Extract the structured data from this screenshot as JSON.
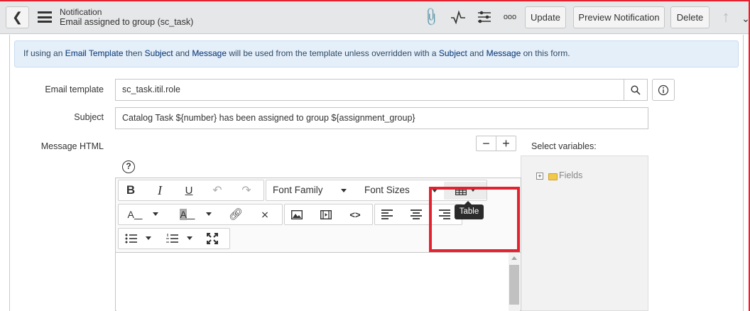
{
  "header": {
    "title": "Notification",
    "subtitle": "Email assigned to group (sc_task)",
    "buttons": {
      "update": "Update",
      "preview": "Preview Notification",
      "delete": "Delete"
    }
  },
  "banner": {
    "p1": "If using an ",
    "b1": "Email Template",
    "p2": " then ",
    "b2": "Subject",
    "p3": " and ",
    "b3": "Message",
    "p4": " will be used from the template unless overridden with a ",
    "b4": "Subject",
    "p5": " and ",
    "b5": "Message",
    "p6": " on this form."
  },
  "form": {
    "email_template_label": "Email template",
    "email_template_value": "sc_task.itil.role",
    "subject_label": "Subject",
    "subject_value": "Catalog Task ${number} has been assigned to group ${assignment_group}",
    "message_label": "Message HTML",
    "select_variables_label": "Select variables:",
    "fields_node": "Fields"
  },
  "editor": {
    "font_family": "Font Family",
    "font_sizes": "Font Sizes",
    "tooltip": "Table"
  },
  "colors": {
    "highlight_box": "#e3222f",
    "accent": "#1f4a82"
  }
}
